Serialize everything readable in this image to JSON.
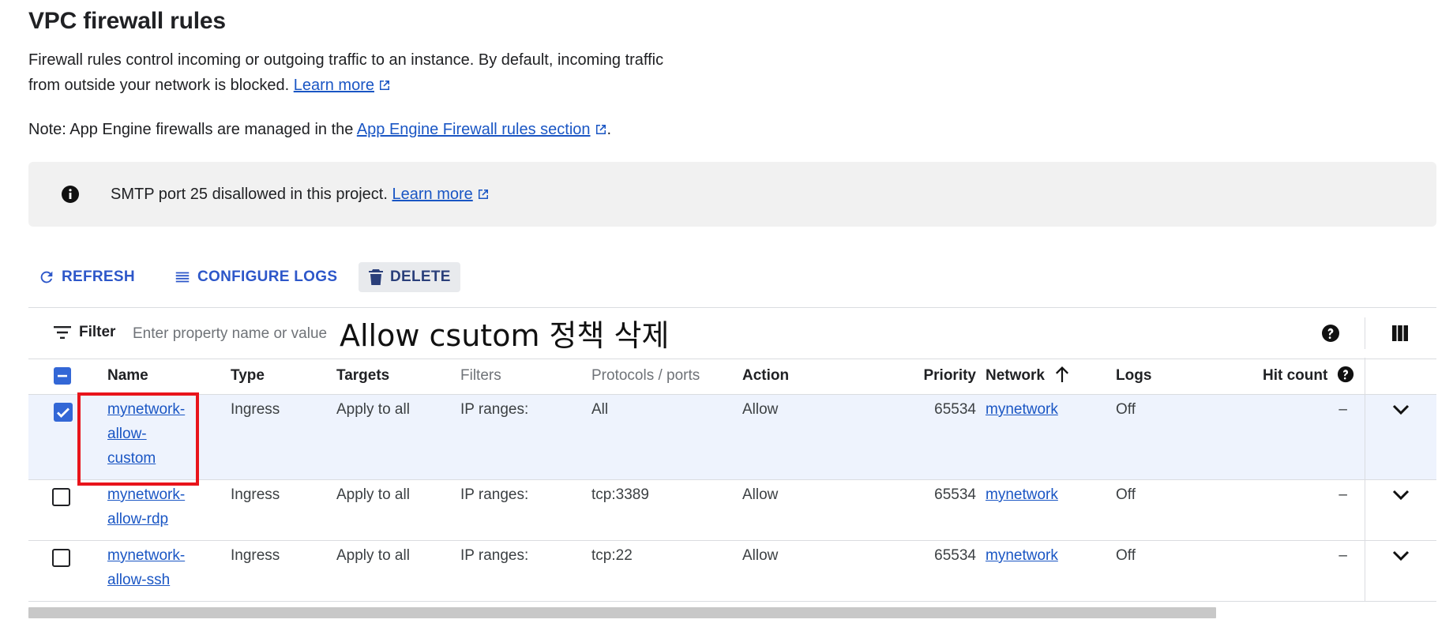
{
  "page": {
    "title": "VPC firewall rules",
    "description": "Firewall rules control incoming or outgoing traffic to an instance. By default, incoming traffic from outside your network is blocked.",
    "learn_more": "Learn more",
    "note_prefix": "Note: App Engine firewalls are managed in the",
    "note_link": "App Engine Firewall rules section",
    "note_suffix": "."
  },
  "banner": {
    "text": "SMTP port 25 disallowed in this project.",
    "link": "Learn more",
    "icon": "info-icon"
  },
  "toolbar": {
    "refresh": "REFRESH",
    "configure_logs": "CONFIGURE LOGS",
    "delete": "DELETE"
  },
  "filter": {
    "label": "Filter",
    "placeholder": "Enter property name or value"
  },
  "annotation": "Allow csutom 정책 삭제",
  "table": {
    "headers": {
      "name": "Name",
      "type": "Type",
      "targets": "Targets",
      "filters": "Filters",
      "protocols": "Protocols / ports",
      "action": "Action",
      "priority": "Priority",
      "network": "Network",
      "logs": "Logs",
      "hit_count": "Hit count"
    },
    "sort": {
      "column": "Network",
      "direction": "ascending"
    },
    "rows": [
      {
        "name_lines": [
          "mynetwork-",
          "allow-",
          "custom"
        ],
        "type": "Ingress",
        "targets": "Apply to all",
        "filters": "IP ranges:",
        "protocols": "All",
        "action": "Allow",
        "priority": "65534",
        "network": "mynetwork",
        "logs": "Off",
        "hit_count": "–",
        "checked": true
      },
      {
        "name_lines": [
          "mynetwork-",
          "allow-rdp"
        ],
        "type": "Ingress",
        "targets": "Apply to all",
        "filters": "IP ranges:",
        "protocols": "tcp:3389",
        "action": "Allow",
        "priority": "65534",
        "network": "mynetwork",
        "logs": "Off",
        "hit_count": "–",
        "checked": false
      },
      {
        "name_lines": [
          "mynetwork-",
          "allow-ssh"
        ],
        "type": "Ingress",
        "targets": "Apply to all",
        "filters": "IP ranges:",
        "protocols": "tcp:22",
        "action": "Allow",
        "priority": "65534",
        "network": "mynetwork",
        "logs": "Off",
        "hit_count": "–",
        "checked": false
      }
    ]
  },
  "colors": {
    "link": "#1a56c4",
    "accent": "#3367d6",
    "selected_row": "#eef3fd",
    "highlight_box": "#e8141b",
    "banner_bg": "#f1f1f1"
  }
}
